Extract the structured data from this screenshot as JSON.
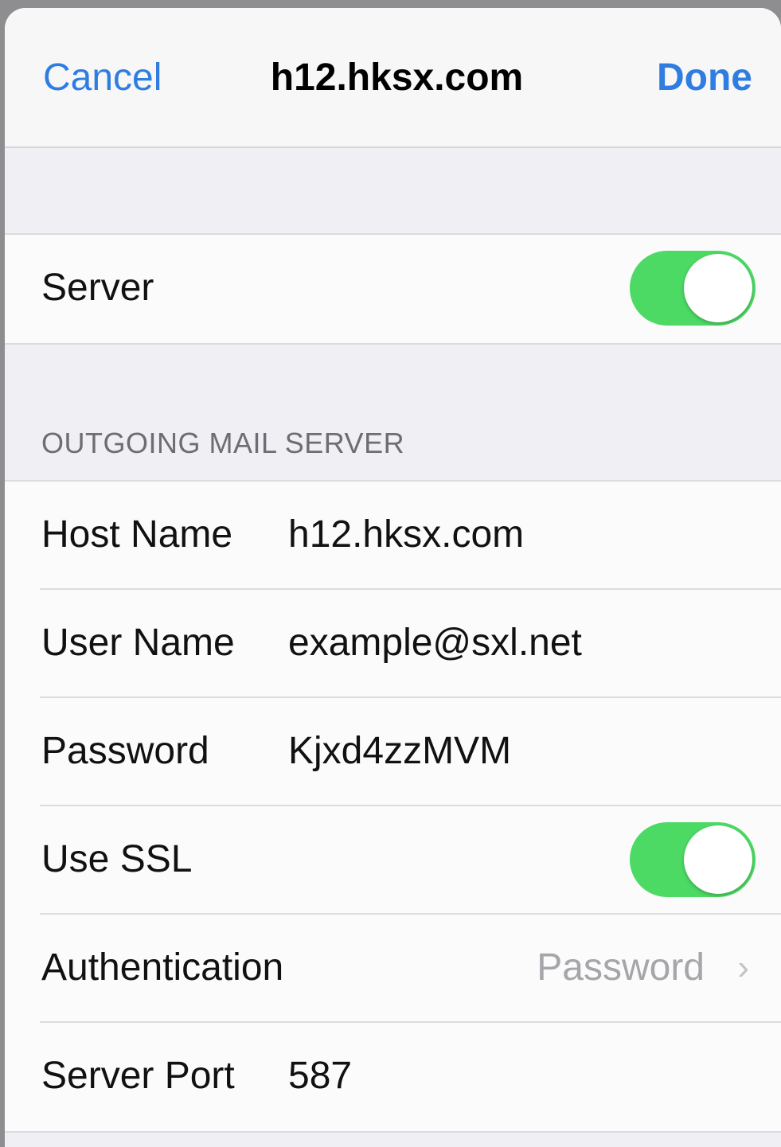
{
  "nav": {
    "cancel": "Cancel",
    "title": "h12.hksx.com",
    "done": "Done"
  },
  "server_group": {
    "server_label": "Server",
    "server_enabled": true
  },
  "outgoing": {
    "header": "OUTGOING MAIL SERVER",
    "rows": {
      "host_name": {
        "label": "Host Name",
        "value": "h12.hksx.com"
      },
      "user_name": {
        "label": "User Name",
        "value": "example@sxl.net"
      },
      "password": {
        "label": "Password",
        "value": "Kjxd4zzMVM"
      },
      "use_ssl": {
        "label": "Use SSL",
        "enabled": true
      },
      "authentication": {
        "label": "Authentication",
        "value": "Password"
      },
      "server_port": {
        "label": "Server Port",
        "value": "587"
      }
    }
  },
  "colors": {
    "accent": "#2f7de1",
    "toggle_on": "#4cd964",
    "background": "#efeff4"
  },
  "icons": {
    "disclosure": "chevron-right-icon"
  }
}
